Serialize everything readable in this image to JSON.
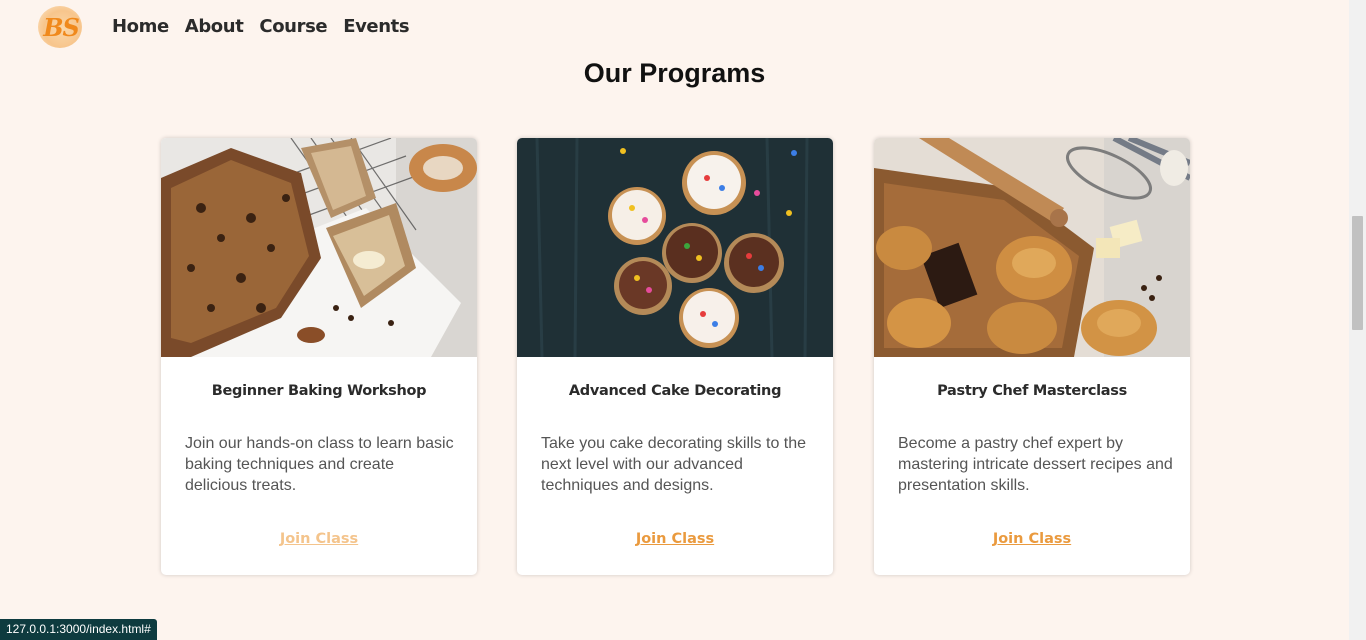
{
  "brand": {
    "logo_text": "BS"
  },
  "nav": {
    "items": [
      "Home",
      "About",
      "Course",
      "Events"
    ]
  },
  "section": {
    "title": "Our Programs"
  },
  "programs": [
    {
      "title": "Beginner Baking Workshop",
      "description": "Join our hands-on class to learn basic baking techniques and create delicious treats.",
      "link": "Join Class",
      "image": "banana-bread-photo"
    },
    {
      "title": "Advanced Cake Decorating",
      "description": "Take you cake decorating skills to the next level with our advanced techniques and designs.",
      "link": "Join Class",
      "image": "cupcakes-photo"
    },
    {
      "title": "Pastry Chef Masterclass",
      "description": "Become a pastry chef expert by mastering intricate dessert recipes and presentation skills.",
      "link": "Join Class",
      "image": "pastries-photo"
    }
  ],
  "status_bar": {
    "url": "127.0.0.1:3000/index.html#"
  },
  "colors": {
    "background": "#fdf4ee",
    "accent": "#ea9a3e",
    "accent_faded": "#f4c48c"
  }
}
